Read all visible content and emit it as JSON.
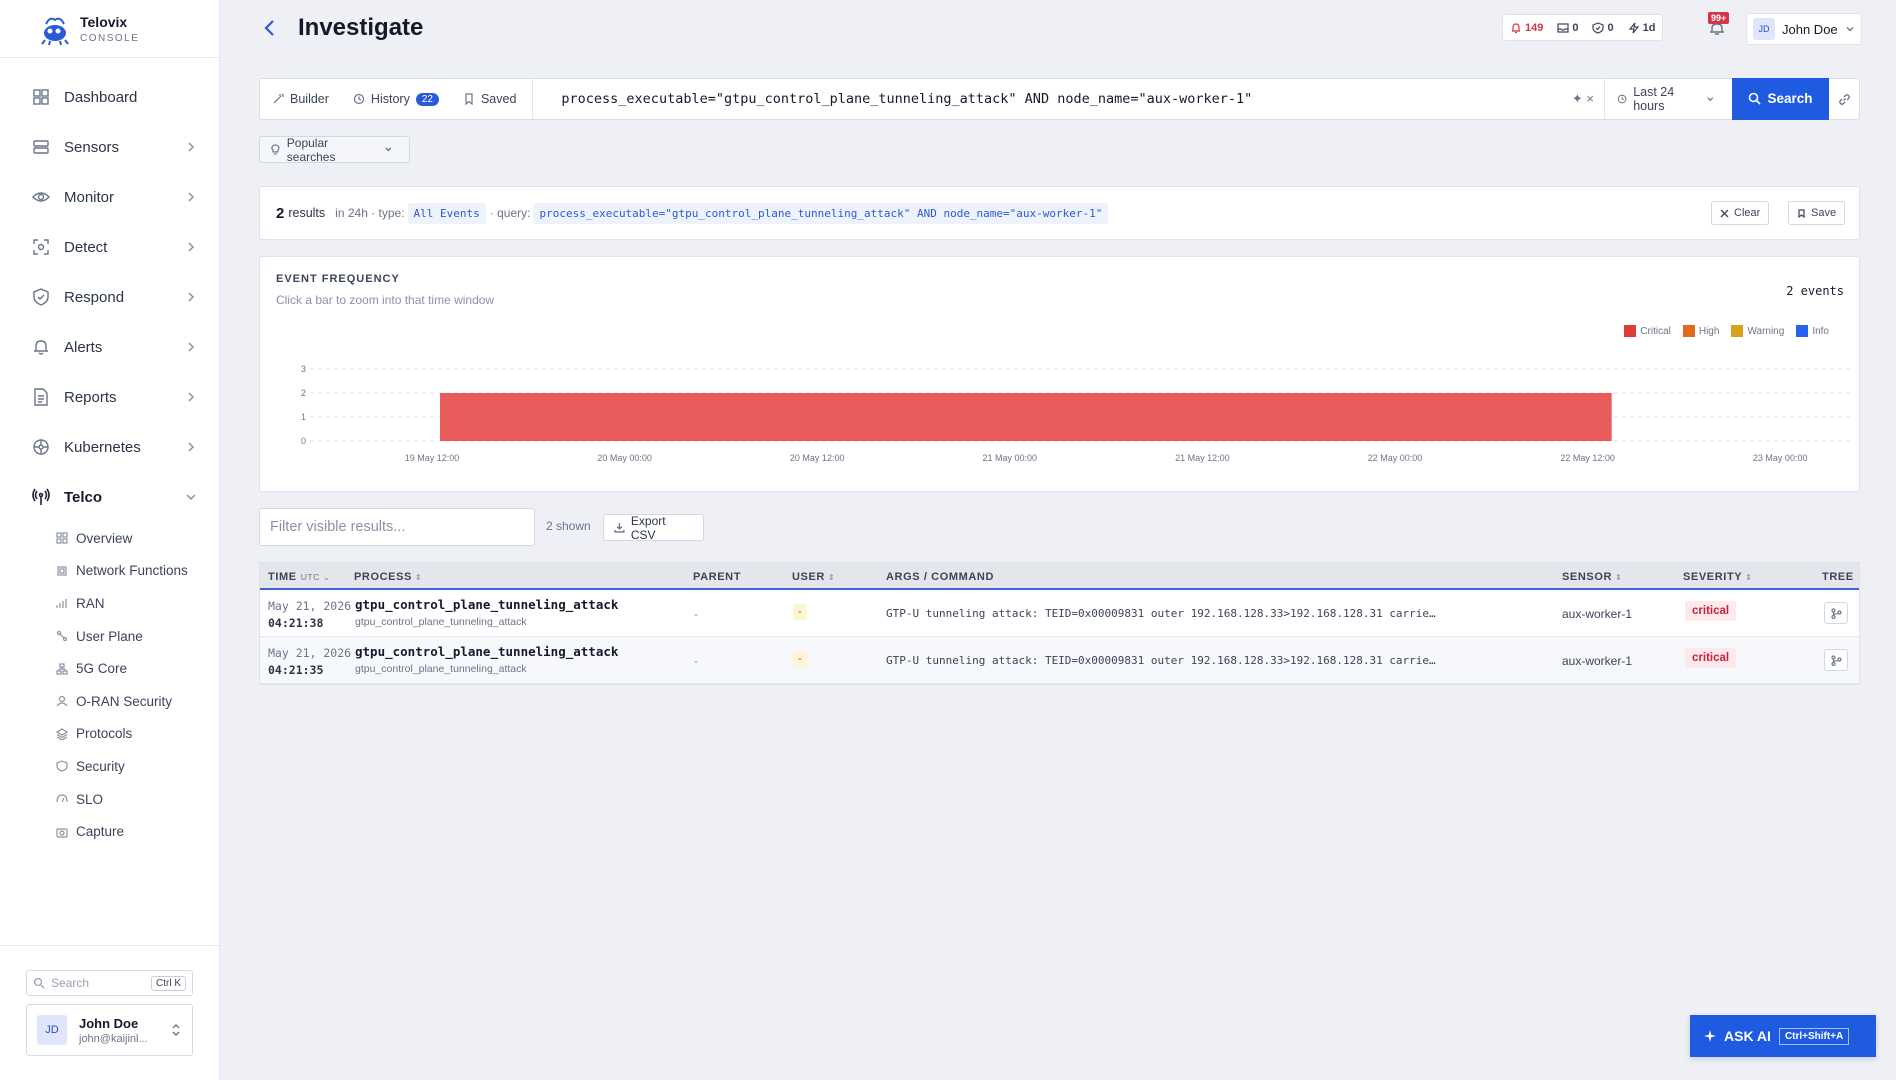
{
  "brand": {
    "name": "Telovix",
    "sub": "CONSOLE"
  },
  "nav": {
    "dashboard": "Dashboard",
    "sensors": "Sensors",
    "monitor": "Monitor",
    "detect": "Detect",
    "respond": "Respond",
    "alerts": "Alerts",
    "reports": "Reports",
    "kubernetes": "Kubernetes",
    "telco": "Telco"
  },
  "telco_sub": {
    "overview": "Overview",
    "network_functions": "Network Functions",
    "ran": "RAN",
    "user_plane": "User Plane",
    "core_5g": "5G Core",
    "oran": "O-RAN Security",
    "protocols": "Protocols",
    "security": "Security",
    "slo": "SLO",
    "capture": "Capture"
  },
  "sidebar_bottom": {
    "search_placeholder": "Search",
    "search_kbd": "Ctrl K",
    "user_initials": "JD",
    "user_name": "John Doe",
    "user_email": "john@kaijinl..."
  },
  "header": {
    "title": "Investigate",
    "alerts_count": "149",
    "count2": "0",
    "count3": "0",
    "range": "1d",
    "notif_badge": "99+",
    "user_initials": "JD",
    "user_name": "John Doe"
  },
  "query": {
    "tab_builder": "Builder",
    "tab_history": "History",
    "history_count": "22",
    "tab_saved": "Saved",
    "text": "process_executable=\"gtpu_control_plane_tunneling_attack\" AND node_name=\"aux-worker-1\"",
    "clear": "✦ ×",
    "time_range": "Last 24 hours",
    "search_label": "Search",
    "popular": "Popular searches"
  },
  "summary": {
    "count": "2",
    "results_label": "results",
    "in_range": "in 24h · type:",
    "type_value": "All Events",
    "query_label": "· query:",
    "query_value": "process_executable=\"gtpu_control_plane_tunneling_attack\" AND node_name=\"aux-worker-1\"",
    "clear_label": "Clear",
    "save_label": "Save"
  },
  "chart": {
    "title": "EVENT FREQUENCY",
    "subtitle": "Click a bar to zoom into that time window",
    "events_label": "2 events",
    "legend": [
      {
        "name": "Critical",
        "color": "#e03c3c"
      },
      {
        "name": "High",
        "color": "#e06a1f"
      },
      {
        "name": "Warning",
        "color": "#d8a21c"
      },
      {
        "name": "Info",
        "color": "#2563eb"
      }
    ]
  },
  "chart_data": {
    "type": "bar",
    "title": "EVENT FREQUENCY",
    "xlabel": "",
    "ylabel": "",
    "ylim": [
      0,
      3
    ],
    "yticks": [
      "0",
      "1",
      "2",
      "3"
    ],
    "x_ticks": [
      "19 May 12:00",
      "20 May 00:00",
      "20 May 12:00",
      "21 May 00:00",
      "21 May 12:00",
      "22 May 00:00",
      "22 May 12:00",
      "23 May 00:00"
    ],
    "bars": [
      {
        "series": "Critical",
        "start": "19 May 12:30",
        "end": "22 May 13:30",
        "value": 2
      }
    ],
    "bar_color": "#e85c5c",
    "grid": "horizontal dashed",
    "legend_position": "top-right"
  },
  "table_controls": {
    "filter_placeholder": "Filter visible results...",
    "shown": "2 shown",
    "export": "Export CSV"
  },
  "table": {
    "headers": {
      "time": "TIME",
      "utc": "UTC",
      "process": "PROCESS",
      "parent": "PARENT",
      "user": "USER",
      "args": "ARGS / COMMAND",
      "sensor": "SENSOR",
      "severity": "SEVERITY",
      "tree": "TREE"
    },
    "rows": [
      {
        "date": "May 21, 2026",
        "time": "04:21:38",
        "process": "gtpu_control_plane_tunneling_attack",
        "process_sub": "gtpu_control_plane_tunneling_attack",
        "parent": "-",
        "user": "-",
        "args": "GTP-U tunneling attack: TEID=0x00009831 outer 192.168.128.33>192.168.128.31 carrie…",
        "sensor": "aux-worker-1",
        "severity": "critical"
      },
      {
        "date": "May 21, 2026",
        "time": "04:21:35",
        "process": "gtpu_control_plane_tunneling_attack",
        "process_sub": "gtpu_control_plane_tunneling_attack",
        "parent": "-",
        "user": "-",
        "args": "GTP-U tunneling attack: TEID=0x00009831 outer 192.168.128.33>192.168.128.31 carrie…",
        "sensor": "aux-worker-1",
        "severity": "critical"
      }
    ]
  },
  "ask_ai": {
    "label": "ASK AI",
    "kbd": "Ctrl+Shift+A"
  }
}
